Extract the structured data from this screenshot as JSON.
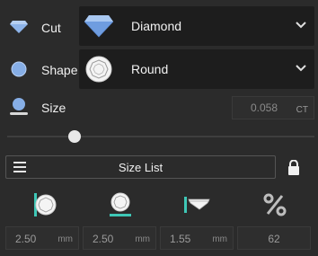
{
  "cut": {
    "label": "Cut",
    "value": "Diamond",
    "icon": "diamond-icon"
  },
  "shape": {
    "label": "Shape",
    "value": "Round",
    "icon": "round-shape-icon"
  },
  "size": {
    "label": "Size",
    "value": "0.058",
    "unit": "CT",
    "slider_fraction": 0.22
  },
  "size_list": {
    "label": "Size List",
    "locked": true
  },
  "measurements": [
    {
      "name": "length",
      "value": "2.50",
      "unit": "mm",
      "icon": "length-measure-icon"
    },
    {
      "name": "width",
      "value": "2.50",
      "unit": "mm",
      "icon": "width-measure-icon"
    },
    {
      "name": "depth",
      "value": "1.55",
      "unit": "mm",
      "icon": "depth-measure-icon"
    },
    {
      "name": "percent",
      "value": "62",
      "unit": "",
      "icon": "percent-icon"
    }
  ],
  "colors": {
    "accent": "#7aa8e6",
    "teal": "#3ec7b6",
    "background": "#2b2b2b"
  }
}
